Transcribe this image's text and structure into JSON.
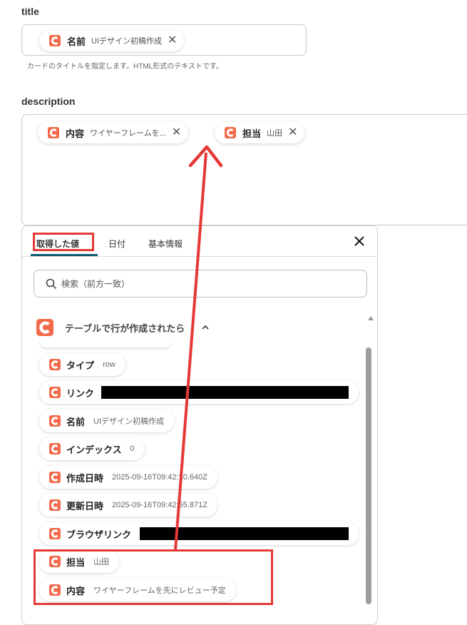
{
  "title_section": {
    "label": "title",
    "chip": {
      "key": "名前",
      "value": "UIデザイン初稿作成"
    },
    "hint": "カードのタイトルを指定します。HTML形式のテキストです。"
  },
  "description_section": {
    "label": "description",
    "chips": [
      {
        "key": "内容",
        "value": "ワイヤーフレームを..."
      },
      {
        "key": "担当",
        "value": "山田"
      }
    ]
  },
  "picker": {
    "tabs": [
      "取得した値",
      "日付",
      "基本情報"
    ],
    "active_tab": "取得した値",
    "search_placeholder": "検索（前方一致）",
    "group_title": "テーブルで行が作成されたら",
    "rows": [
      {
        "key": "タイプ",
        "value": "row"
      },
      {
        "key": "リンク",
        "value": ""
      },
      {
        "key": "名前",
        "value": "UIデザイン初稿作成"
      },
      {
        "key": "インデックス",
        "value": "0"
      },
      {
        "key": "作成日時",
        "value": "2025-09-16T09:42:10.640Z"
      },
      {
        "key": "更新日時",
        "value": "2025-09-16T09:42:55.871Z"
      },
      {
        "key": "ブラウザリンク",
        "value": ""
      },
      {
        "key": "担当",
        "value": "山田"
      },
      {
        "key": "内容",
        "value": "ワイヤーフレームを先にレビュー予定"
      }
    ]
  },
  "colors": {
    "brand": "#f26a4b",
    "highlight": "#e53935",
    "tab_underline": "#0f5d73"
  }
}
